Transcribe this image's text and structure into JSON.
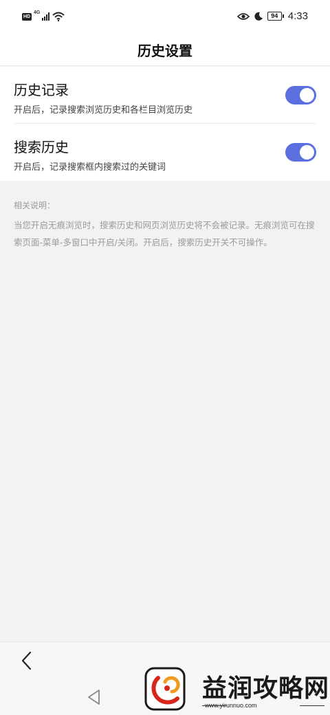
{
  "status_bar": {
    "left_badge": "HD",
    "network_label": "4G",
    "time": "4:33",
    "battery": "94",
    "icons": [
      "hd-icon",
      "signal-icon",
      "wifi-icon",
      "eye-icon",
      "moon-icon",
      "battery-icon"
    ]
  },
  "header": {
    "title": "历史设置"
  },
  "settings": [
    {
      "title": "历史记录",
      "description": "开启后，记录搜索浏览历史和各栏目浏览历史",
      "enabled": true
    },
    {
      "title": "搜索历史",
      "description": "开启后，记录搜索框内搜索过的关键词",
      "enabled": true
    }
  ],
  "notes": {
    "title": "相关说明：",
    "body": "当您开启无痕浏览时，搜索历史和网页浏览历史将不会被记录。无痕浏览可在搜索页面-菜单-多窗口中开启/关闭。开启后，搜索历史开关不可操作。"
  },
  "nav": {
    "icons": [
      "back-icon",
      "home-triangle-icon"
    ]
  },
  "watermark": {
    "text": "益润攻略网",
    "url": "www.yirunnuo.com"
  },
  "colors": {
    "accent": "#5b6fe0",
    "background": "#f2f2f2",
    "note_text": "#9a9a9a"
  }
}
